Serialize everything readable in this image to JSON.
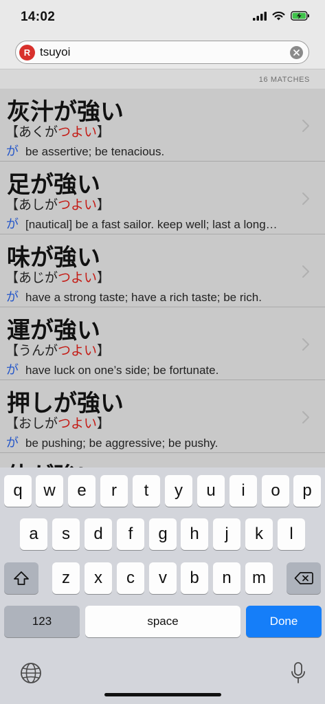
{
  "status": {
    "time": "14:02"
  },
  "search": {
    "badge": "R",
    "query": "tsuyoi"
  },
  "matches_label": "16 MATCHES",
  "results": [
    {
      "headword": "灰汁が強い",
      "reading_open": "【",
      "reading_plain": "あくが",
      "reading_red": "つよい",
      "reading_close": "】",
      "pos": "が",
      "definition": "be assertive; be tenacious."
    },
    {
      "headword": "足が強い",
      "reading_open": "【",
      "reading_plain": "あしが",
      "reading_red": "つよい",
      "reading_close": "】",
      "pos": "が",
      "definition": "[nautical] be a fast sailor. keep well; last a long…"
    },
    {
      "headword": "味が強い",
      "reading_open": "【",
      "reading_plain": "あじが",
      "reading_red": "つよい",
      "reading_close": "】",
      "pos": "が",
      "definition": "have a strong taste; have a rich taste; be rich."
    },
    {
      "headword": "運が強い",
      "reading_open": "【",
      "reading_plain": "うんが",
      "reading_red": "つよい",
      "reading_close": "】",
      "pos": "が",
      "definition": "have luck on one’s side; be fortunate."
    },
    {
      "headword": "押しが強い",
      "reading_open": "【",
      "reading_plain": "おしが",
      "reading_red": "つよい",
      "reading_close": "】",
      "pos": "が",
      "definition": "be pushing; be aggressive; be pushy."
    },
    {
      "headword": "体が強い",
      "reading_open": "",
      "reading_plain": "",
      "reading_red": "",
      "reading_close": "",
      "pos": "",
      "definition": ""
    }
  ],
  "keyboard": {
    "row1": [
      "q",
      "w",
      "e",
      "r",
      "t",
      "y",
      "u",
      "i",
      "o",
      "p"
    ],
    "row2": [
      "a",
      "s",
      "d",
      "f",
      "g",
      "h",
      "j",
      "k",
      "l"
    ],
    "row3": [
      "z",
      "x",
      "c",
      "v",
      "b",
      "n",
      "m"
    ],
    "numbers_label": "123",
    "space_label": "space",
    "done_label": "Done"
  },
  "colors": {
    "accent": "#157ef9",
    "reading_red": "#c41a14",
    "pos_blue": "#2456c9",
    "badge_red": "#d8312c"
  }
}
